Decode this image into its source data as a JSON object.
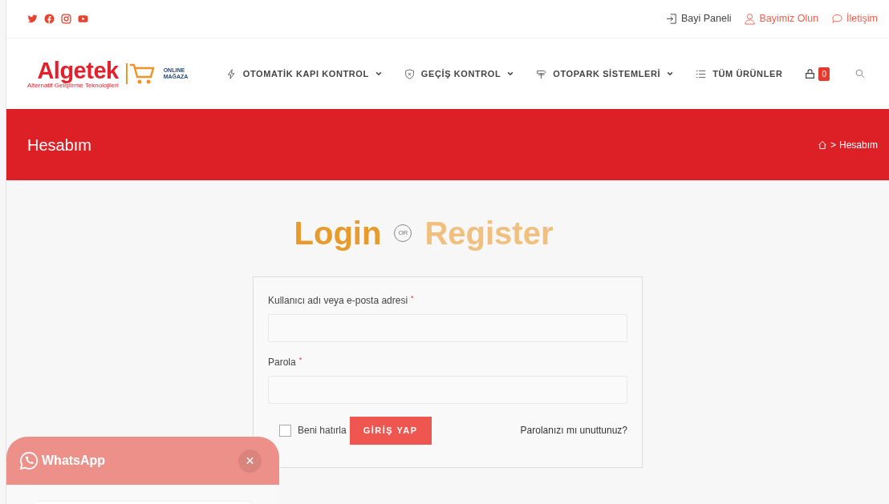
{
  "topbar": {
    "links": [
      {
        "label": "Bayi Paneli",
        "accent": false
      },
      {
        "label": "Bayimiz Olun",
        "accent": true
      },
      {
        "label": "İletişim",
        "accent": true
      }
    ]
  },
  "logo": {
    "name": "Algetek",
    "tagline": "Alternatif Geliştirme Teknolojileri",
    "badge_top": "ONLINE",
    "badge_bottom": "MAĞAZA"
  },
  "nav": [
    {
      "label": "OTOMATİK KAPI KONTROL",
      "dropdown": true
    },
    {
      "label": "GEÇİŞ KONTROL",
      "dropdown": true
    },
    {
      "label": "OTOPARK SİSTEMLERİ",
      "dropdown": true
    },
    {
      "label": "TÜM ÜRÜNLER",
      "dropdown": false
    }
  ],
  "cart_count": "0",
  "page_title": "Hesabım",
  "breadcrumb": {
    "separator": ">",
    "current": "Hesabım"
  },
  "auth_tabs": [
    {
      "label": "Login",
      "selected": true
    },
    {
      "label": "Register",
      "selected": false
    }
  ],
  "or_label": "OR",
  "form": {
    "fields": [
      {
        "label": "Kullanıcı adı veya e-posta adresi",
        "required_mark": "*"
      },
      {
        "label": "Parola",
        "required_mark": "*"
      }
    ],
    "remember": {
      "label": "Beni hatırla",
      "checked": false
    },
    "submit": "GİRİŞ YAP",
    "forgot": "Parolanızı mı unuttunuz?"
  },
  "whatsapp": {
    "title": "WhatsApp",
    "close": "×"
  }
}
